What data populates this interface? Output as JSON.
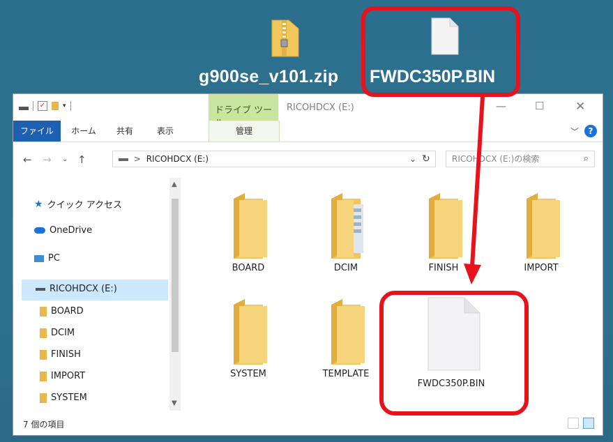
{
  "desktop": {
    "zip_file_label": "g900se_v101.zip",
    "bin_file_label": "FWDC350P.BIN"
  },
  "window": {
    "ribbon_context_label": "ドライブ ツール",
    "title": "RICOHDCX (E:)",
    "tabs": {
      "file": "ファイル",
      "home": "ホーム",
      "share": "共有",
      "view": "表示",
      "manage": "管理"
    },
    "address": {
      "path_root": ">",
      "path": "RICOHDCX (E:)",
      "search_placeholder": "RICOHDCX (E:)の検索"
    },
    "nav": {
      "quick_access": "クイック アクセス",
      "onedrive": "OneDrive",
      "pc": "PC",
      "drive": "RICOHDCX (E:)",
      "folders": [
        "BOARD",
        "DCIM",
        "FINISH",
        "IMPORT",
        "SYSTEM"
      ]
    },
    "content": {
      "items": [
        "BOARD",
        "DCIM",
        "FINISH",
        "IMPORT",
        "SYSTEM",
        "TEMPLATE",
        "FWDC350P.BIN"
      ]
    },
    "status": {
      "item_count": "7 個の項目"
    }
  },
  "colors": {
    "highlight": "#e8121d",
    "desktop": "#2b6e8d",
    "file_tab": "#1d5fb0",
    "drive_tools": "#c9e6a1",
    "folder": "#e8b84f"
  }
}
